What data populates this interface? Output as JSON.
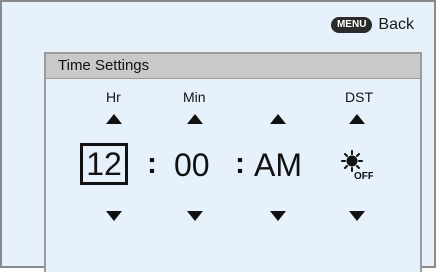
{
  "topbar": {
    "menu_label": "MENU",
    "back_label": "Back"
  },
  "panel": {
    "title": "Time Settings"
  },
  "columns": {
    "hr_label": "Hr",
    "min_label": "Min",
    "dst_label": "DST"
  },
  "values": {
    "hour": "12",
    "minute": "00",
    "ampm": "AM",
    "separator": ":",
    "dst_state": "OFF"
  },
  "icons": {
    "up": "up-arrow-icon",
    "down": "down-arrow-icon",
    "dst": "dst-off-icon"
  }
}
